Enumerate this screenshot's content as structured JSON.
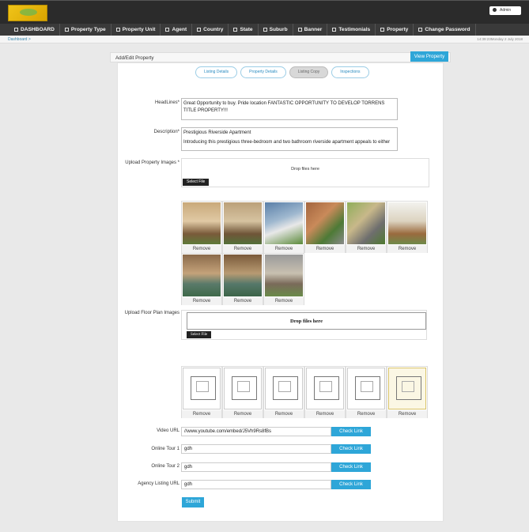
{
  "header": {
    "admin_label": "Admin"
  },
  "nav": [
    {
      "label": "DASHBOARD",
      "icon": "home-icon"
    },
    {
      "label": "Property Type",
      "icon": "doc-icon"
    },
    {
      "label": "Property Unit",
      "icon": "doc-icon"
    },
    {
      "label": "Agent",
      "icon": "doc-icon"
    },
    {
      "label": "Country",
      "icon": "doc-icon"
    },
    {
      "label": "State",
      "icon": "doc-icon"
    },
    {
      "label": "Suburb",
      "icon": "doc-icon"
    },
    {
      "label": "Banner",
      "icon": "doc-icon"
    },
    {
      "label": "Testimonials",
      "icon": "doc-icon"
    },
    {
      "label": "Property",
      "icon": "doc-icon"
    },
    {
      "label": "Change Password",
      "icon": "doc-icon"
    }
  ],
  "breadcrumb": {
    "text": "Dashboard  >"
  },
  "datetime": "14:39:23Monday 2 July 2018",
  "panel": {
    "title": "Add/Edit Property",
    "view_button": "View Property"
  },
  "tabs": [
    "Listing Details",
    "Property Details",
    "Listing Copy",
    "Inspections"
  ],
  "form": {
    "headlines_label": "HeadLines*",
    "headlines_value": "Great Opportunity to buy. Pride location FANTASTIC OPPORTUNITY TO DEVELOP TORRENS TITLE PROPERTY!!!",
    "description_label": "Description*",
    "description_line1": "Prestigious Riverside Apartment",
    "description_line2": "Introducing this prestigious three-bedroom and two bathroom riverside apartment appeals to either",
    "upload_images_label": "Upload Property Images *",
    "drop_text": "Drop files here",
    "select_file": "Select File",
    "remove": "Remove",
    "upload_floor_label": "Upload Floor Plan Images",
    "floor_drop_text": "Drop files here",
    "floor_select_file": "Select File",
    "video_label": "Video URL",
    "video_value": "//www.youtube.com/embed/J5Vh9Rs8fBs",
    "tour1_label": "Online Tour 1",
    "tour1_value": "gdh",
    "tour2_label": "Online Tour 2",
    "tour2_value": "gdh",
    "agency_label": "Agency Listing URL",
    "agency_value": "gdh",
    "check_link": "Check Link",
    "submit": "Submit"
  },
  "colors": {
    "accent": "#2ea6d8",
    "nav_bg": "#3a3a3a",
    "topbar_bg": "#2b2b2b"
  }
}
